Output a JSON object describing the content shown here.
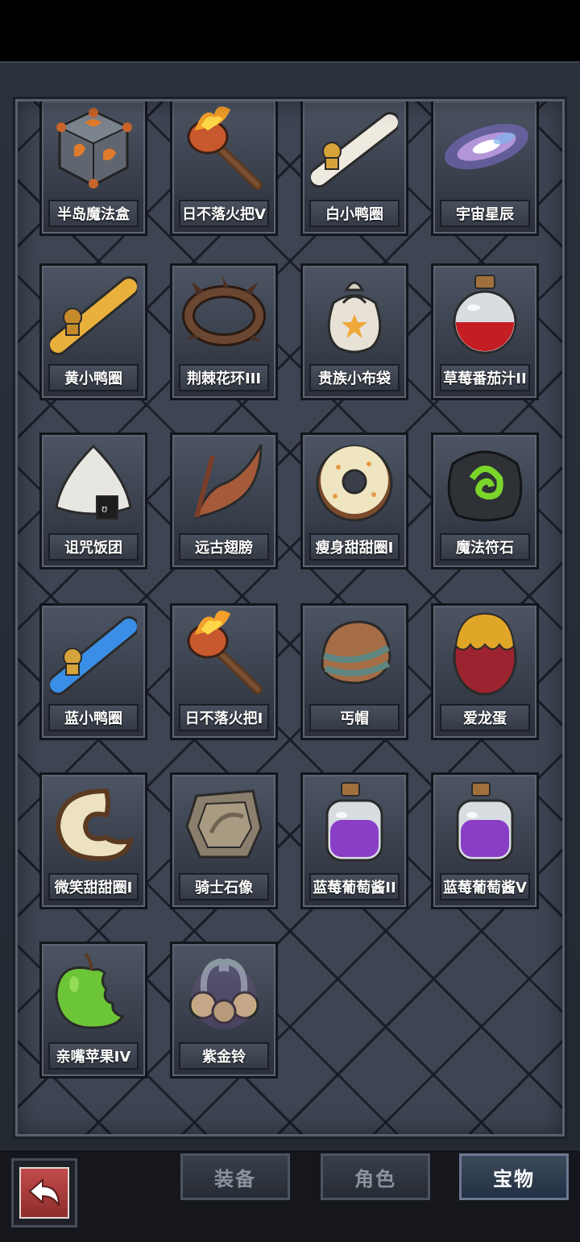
{
  "items": [
    {
      "name": "半岛魔法盒",
      "icon": "magic-cube-icon"
    },
    {
      "name": "日不落火把V",
      "icon": "torch-icon"
    },
    {
      "name": "白小鸭圈",
      "icon": "white-duck-ring-icon"
    },
    {
      "name": "宇宙星辰",
      "icon": "galaxy-icon"
    },
    {
      "name": "黄小鸭圈",
      "icon": "yellow-duck-ring-icon"
    },
    {
      "name": "荆棘花环III",
      "icon": "thorn-wreath-icon"
    },
    {
      "name": "贵族小布袋",
      "icon": "cloth-bag-icon"
    },
    {
      "name": "草莓番茄汁II",
      "icon": "red-potion-icon"
    },
    {
      "name": "诅咒饭团",
      "icon": "rice-ball-icon"
    },
    {
      "name": "远古翅膀",
      "icon": "wing-icon"
    },
    {
      "name": "瘦身甜甜圈I",
      "icon": "donut-icon"
    },
    {
      "name": "魔法符石",
      "icon": "rune-stone-icon"
    },
    {
      "name": "蓝小鸭圈",
      "icon": "blue-duck-ring-icon"
    },
    {
      "name": "日不落火把I",
      "icon": "torch-icon"
    },
    {
      "name": "丐帽",
      "icon": "beggar-hat-icon"
    },
    {
      "name": "爱龙蛋",
      "icon": "dragon-egg-icon"
    },
    {
      "name": "微笑甜甜圈I",
      "icon": "bitten-donut-icon"
    },
    {
      "name": "骑士石像",
      "icon": "stone-tablet-icon"
    },
    {
      "name": "蓝莓葡萄酱II",
      "icon": "purple-potion-icon"
    },
    {
      "name": "蓝莓葡萄酱V",
      "icon": "purple-potion-icon"
    },
    {
      "name": "亲嘴苹果IV",
      "icon": "green-apple-icon"
    },
    {
      "name": "紫金铃",
      "icon": "bells-icon"
    }
  ],
  "tabs": {
    "equipment": "装备",
    "character": "角色",
    "treasure": "宝物"
  },
  "active_tab": "宝物"
}
